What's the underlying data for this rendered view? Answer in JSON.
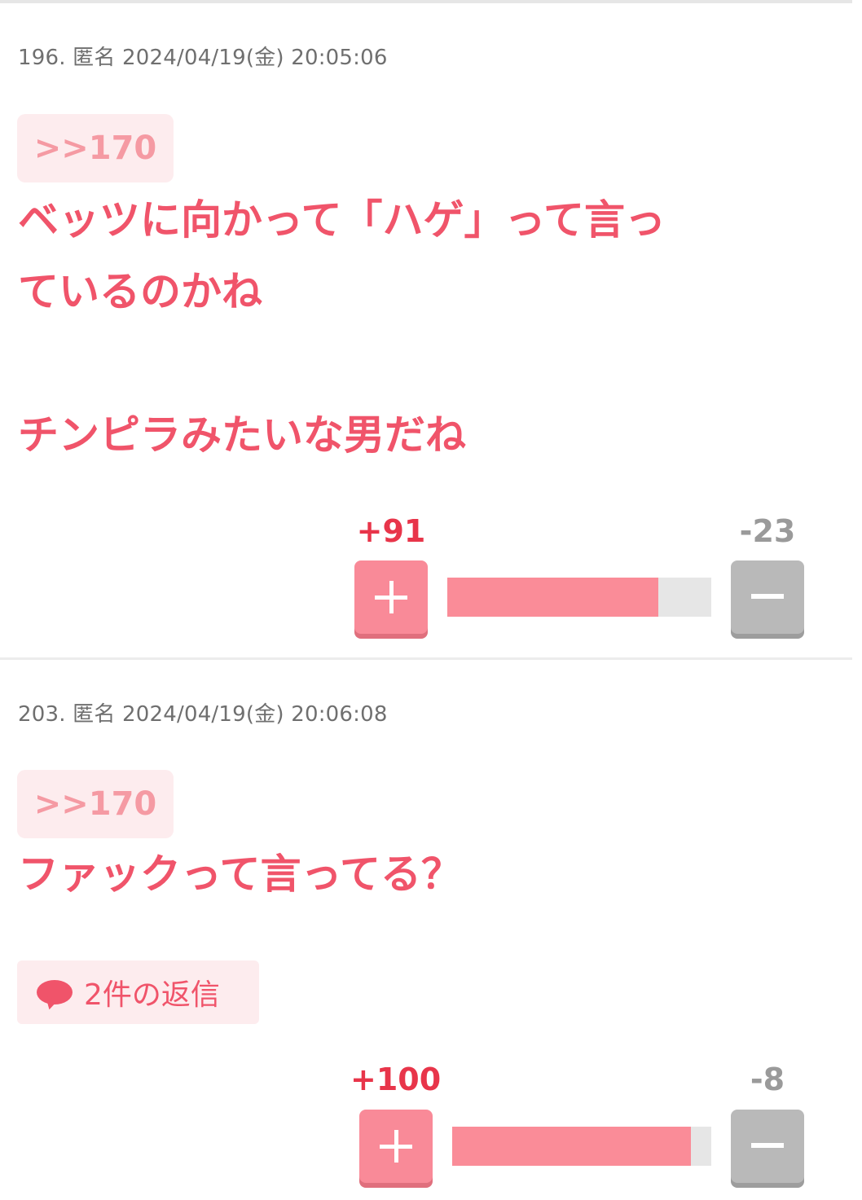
{
  "posts": [
    {
      "meta": "196. 匿名 2024/04/19(金) 20:05:06",
      "anchor": ">>170",
      "body": "ベッツに向かって「ハゲ」って言っ\nているのかね\n\nチンピラみたいな男だね",
      "plus": "+91",
      "minus": "-23",
      "ratio": 0.8
    },
    {
      "meta": "203. 匿名 2024/04/19(金) 20:06:08",
      "anchor": ">>170",
      "body": "ファックって言ってる？",
      "replies": "2件の返信",
      "plus": "+100",
      "minus": "-8",
      "ratio": 0.92
    }
  ],
  "icons": {
    "plus": "plus-icon",
    "minus": "minus-icon",
    "replies": "speech-bubble-icon"
  },
  "colors": {
    "accent": "#f0546a",
    "plus_button": "#f98a98",
    "minus_button": "#b9b9b9",
    "anchor_bg": "#fdecee"
  }
}
